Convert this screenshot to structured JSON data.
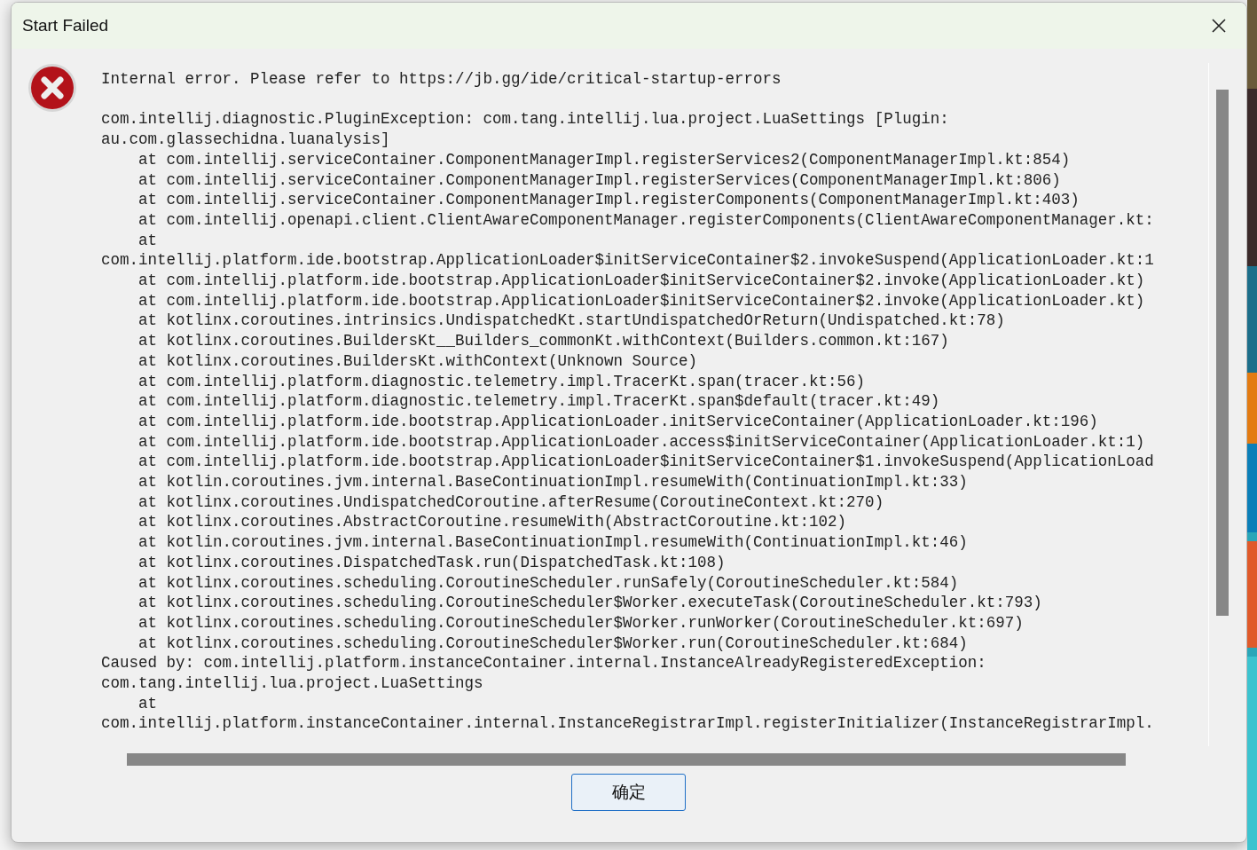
{
  "dialog": {
    "title": "Start Failed",
    "message": "Internal error. Please refer to https://jb.gg/ide/critical-startup-errors",
    "log_lines": [
      "com.intellij.diagnostic.PluginException: com.tang.intellij.lua.project.LuaSettings [Plugin:",
      "au.com.glassechidna.luanalysis]",
      "    at com.intellij.serviceContainer.ComponentManagerImpl.registerServices2(ComponentManagerImpl.kt:854)",
      "    at com.intellij.serviceContainer.ComponentManagerImpl.registerServices(ComponentManagerImpl.kt:806)",
      "    at com.intellij.serviceContainer.ComponentManagerImpl.registerComponents(ComponentManagerImpl.kt:403)",
      "    at com.intellij.openapi.client.ClientAwareComponentManager.registerComponents(ClientAwareComponentManager.kt:",
      "    at",
      "com.intellij.platform.ide.bootstrap.ApplicationLoader$initServiceContainer$2.invokeSuspend(ApplicationLoader.kt:1",
      "    at com.intellij.platform.ide.bootstrap.ApplicationLoader$initServiceContainer$2.invoke(ApplicationLoader.kt)",
      "    at com.intellij.platform.ide.bootstrap.ApplicationLoader$initServiceContainer$2.invoke(ApplicationLoader.kt)",
      "    at kotlinx.coroutines.intrinsics.UndispatchedKt.startUndispatchedOrReturn(Undispatched.kt:78)",
      "    at kotlinx.coroutines.BuildersKt__Builders_commonKt.withContext(Builders.common.kt:167)",
      "    at kotlinx.coroutines.BuildersKt.withContext(Unknown Source)",
      "    at com.intellij.platform.diagnostic.telemetry.impl.TracerKt.span(tracer.kt:56)",
      "    at com.intellij.platform.diagnostic.telemetry.impl.TracerKt.span$default(tracer.kt:49)",
      "    at com.intellij.platform.ide.bootstrap.ApplicationLoader.initServiceContainer(ApplicationLoader.kt:196)",
      "    at com.intellij.platform.ide.bootstrap.ApplicationLoader.access$initServiceContainer(ApplicationLoader.kt:1)",
      "    at com.intellij.platform.ide.bootstrap.ApplicationLoader$initServiceContainer$1.invokeSuspend(ApplicationLoad",
      "    at kotlin.coroutines.jvm.internal.BaseContinuationImpl.resumeWith(ContinuationImpl.kt:33)",
      "    at kotlinx.coroutines.UndispatchedCoroutine.afterResume(CoroutineContext.kt:270)",
      "    at kotlinx.coroutines.AbstractCoroutine.resumeWith(AbstractCoroutine.kt:102)",
      "    at kotlin.coroutines.jvm.internal.BaseContinuationImpl.resumeWith(ContinuationImpl.kt:46)",
      "    at kotlinx.coroutines.DispatchedTask.run(DispatchedTask.kt:108)",
      "    at kotlinx.coroutines.scheduling.CoroutineScheduler.runSafely(CoroutineScheduler.kt:584)",
      "    at kotlinx.coroutines.scheduling.CoroutineScheduler$Worker.executeTask(CoroutineScheduler.kt:793)",
      "    at kotlinx.coroutines.scheduling.CoroutineScheduler$Worker.runWorker(CoroutineScheduler.kt:697)",
      "    at kotlinx.coroutines.scheduling.CoroutineScheduler$Worker.run(CoroutineScheduler.kt:684)",
      "Caused by: com.intellij.platform.instanceContainer.internal.InstanceAlreadyRegisteredException:",
      "com.tang.intellij.lua.project.LuaSettings",
      "    at",
      "com.intellij.platform.instanceContainer.internal.InstanceRegistrarImpl.registerInitializer(InstanceRegistrarImpl."
    ],
    "ok_button": "确定"
  }
}
